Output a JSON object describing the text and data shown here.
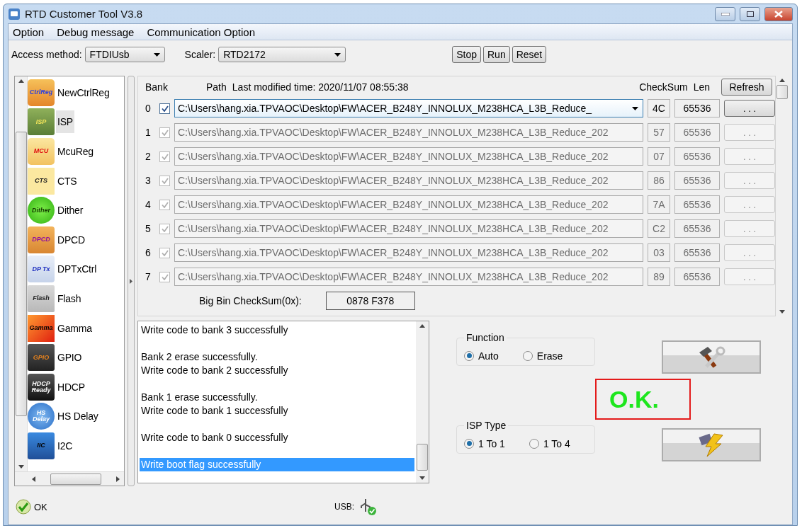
{
  "window": {
    "title": "RTD Customer Tool V3.8"
  },
  "menu": [
    "Option",
    "Debug message",
    "Communication Option"
  ],
  "toolbar": {
    "access_label": "Access method:",
    "access_value": "FTDIUsb",
    "scaler_label": "Scaler:",
    "scaler_value": "RTD2172",
    "buttons": [
      "Stop",
      "Run",
      "Reset"
    ]
  },
  "sidebar": {
    "items": [
      {
        "label": "NewCtrlReg",
        "icon_text": "CtrlReg",
        "selected": false
      },
      {
        "label": "ISP",
        "icon_text": "ISP",
        "selected": true
      },
      {
        "label": "McuReg",
        "icon_text": "MCU",
        "selected": false
      },
      {
        "label": "CTS",
        "icon_text": "CTS",
        "selected": false
      },
      {
        "label": "Dither",
        "icon_text": "Dither",
        "selected": false
      },
      {
        "label": "DPCD",
        "icon_text": "DPCD",
        "selected": false
      },
      {
        "label": "DPTxCtrl",
        "icon_text": "DP Tx",
        "selected": false
      },
      {
        "label": "Flash",
        "icon_text": "Flash",
        "selected": false
      },
      {
        "label": "Gamma",
        "icon_text": "Gamma",
        "selected": false
      },
      {
        "label": "GPIO",
        "icon_text": "GPIO",
        "selected": false
      },
      {
        "label": "HDCP",
        "icon_text": "HDCP Ready",
        "selected": false
      },
      {
        "label": "HS Delay",
        "icon_text": "HS Delay",
        "selected": false
      },
      {
        "label": "I2C",
        "icon_text": "IIC",
        "selected": false
      }
    ]
  },
  "table": {
    "columns": {
      "bank": "Bank",
      "path": "Path",
      "modified": "Last modified time: 2020/11/07 08:55:38",
      "checksum": "CheckSum",
      "len": "Len"
    },
    "refresh": "Refresh",
    "rows": [
      {
        "bank": "0",
        "checked": true,
        "disabled": false,
        "path": "C:\\Users\\hang.xia.TPVAOC\\Desktop\\FW\\ACER_B248Y_INNOLUX_M238HCA_L3B_Reduce_",
        "checksum": "4C",
        "len": "65536",
        "browse": ". . ."
      },
      {
        "bank": "1",
        "checked": true,
        "disabled": true,
        "path": "C:\\Users\\hang.xia.TPVAOC\\Desktop\\FW\\ACER_B248Y_INNOLUX_M238HCA_L3B_Reduce_202",
        "checksum": "57",
        "len": "65536",
        "browse": ". . ."
      },
      {
        "bank": "2",
        "checked": true,
        "disabled": true,
        "path": "C:\\Users\\hang.xia.TPVAOC\\Desktop\\FW\\ACER_B248Y_INNOLUX_M238HCA_L3B_Reduce_202",
        "checksum": "07",
        "len": "65536",
        "browse": ". . ."
      },
      {
        "bank": "3",
        "checked": true,
        "disabled": true,
        "path": "C:\\Users\\hang.xia.TPVAOC\\Desktop\\FW\\ACER_B248Y_INNOLUX_M238HCA_L3B_Reduce_202",
        "checksum": "86",
        "len": "65536",
        "browse": ". . ."
      },
      {
        "bank": "4",
        "checked": true,
        "disabled": true,
        "path": "C:\\Users\\hang.xia.TPVAOC\\Desktop\\FW\\ACER_B248Y_INNOLUX_M238HCA_L3B_Reduce_202",
        "checksum": "7A",
        "len": "65536",
        "browse": ". . ."
      },
      {
        "bank": "5",
        "checked": true,
        "disabled": true,
        "path": "C:\\Users\\hang.xia.TPVAOC\\Desktop\\FW\\ACER_B248Y_INNOLUX_M238HCA_L3B_Reduce_202",
        "checksum": "C2",
        "len": "65536",
        "browse": ". . ."
      },
      {
        "bank": "6",
        "checked": true,
        "disabled": true,
        "path": "C:\\Users\\hang.xia.TPVAOC\\Desktop\\FW\\ACER_B248Y_INNOLUX_M238HCA_L3B_Reduce_202",
        "checksum": "03",
        "len": "65536",
        "browse": ". . ."
      },
      {
        "bank": "7",
        "checked": true,
        "disabled": true,
        "path": "C:\\Users\\hang.xia.TPVAOC\\Desktop\\FW\\ACER_B248Y_INNOLUX_M238HCA_L3B_Reduce_202",
        "checksum": "89",
        "len": "65536",
        "browse": ". . ."
      }
    ]
  },
  "bigbin": {
    "label": "Big Bin CheckSum(0x):",
    "value": "0878 F378"
  },
  "log": {
    "entries": [
      {
        "lines": [
          "Write code to bank 3 successfully"
        ],
        "selected": false
      },
      {
        "lines": [
          "Bank 2 erase successfully.",
          "Write code to bank 2 successfully"
        ],
        "selected": false
      },
      {
        "lines": [
          "Bank 1 erase successfully.",
          "Write code to bank 1 successfully"
        ],
        "selected": false
      },
      {
        "lines": [
          "Write code to bank 0 successfully"
        ],
        "selected": false
      },
      {
        "lines": [
          "Write boot flag successfully"
        ],
        "selected": true
      }
    ]
  },
  "function": {
    "title": "Function",
    "options": [
      {
        "label": "Auto",
        "selected": true
      },
      {
        "label": "Erase",
        "selected": false
      }
    ]
  },
  "isp_type": {
    "title": "ISP Type",
    "options": [
      {
        "label": "1 To 1",
        "selected": true
      },
      {
        "label": "1 To 4",
        "selected": false
      }
    ]
  },
  "result": "O.K.",
  "status": {
    "text": "OK",
    "usb_label": "USB:"
  }
}
